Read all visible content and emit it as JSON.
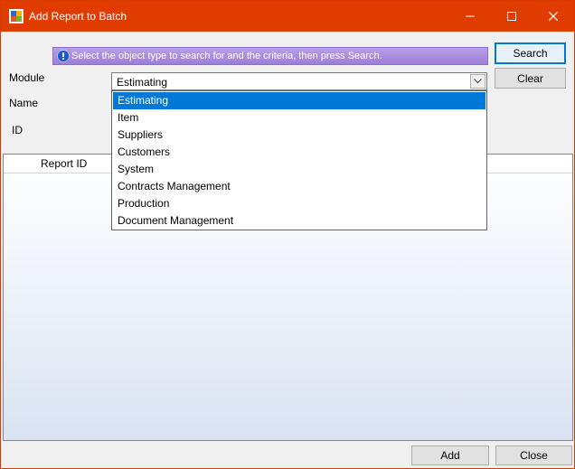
{
  "window": {
    "title": "Add Report to Batch"
  },
  "info_banner": {
    "text": "Select the object type to search for and the criteria, then press Search."
  },
  "buttons": {
    "search": "Search",
    "clear": "Clear",
    "add": "Add",
    "close": "Close"
  },
  "fields": {
    "module_label": "Module",
    "name_label": "Name",
    "id_label": "ID",
    "module_value": "Estimating"
  },
  "module_options": [
    "Estimating",
    "Item",
    "Suppliers",
    "Customers",
    "System",
    "Contracts Management",
    "Production",
    "Document Management"
  ],
  "selected_option_index": 0,
  "grid": {
    "columns": [
      "Report ID"
    ]
  },
  "colors": {
    "title_bar": "#e03c00",
    "selection": "#0078d7",
    "banner": "#9e7ed9"
  }
}
